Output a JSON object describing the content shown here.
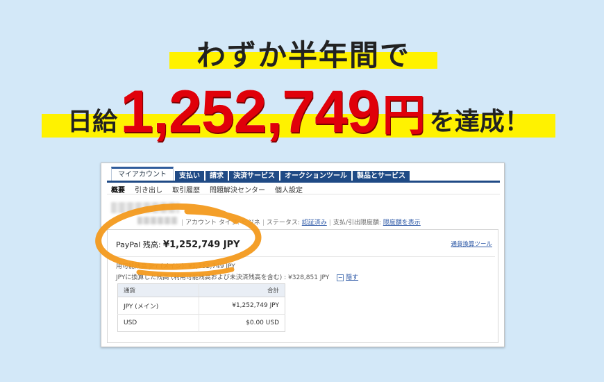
{
  "headline": {
    "line1": "わずか半年間で",
    "prefix": "日給",
    "amount": "1,252,749",
    "unit": "円",
    "suffix": "を達成！"
  },
  "nav": {
    "tabs": [
      "マイアカウント",
      "支払い",
      "請求",
      "決済サービス",
      "オークションツール",
      "製品とサービス"
    ],
    "subnav": [
      "概要",
      "引き出し",
      "取引履歴",
      "問題解決センター",
      "個人設定"
    ]
  },
  "account": {
    "type_label": "アカウント タイプ: ビジネ",
    "status_label": "ステータス:",
    "status_value": "認証済み",
    "limit_label": "支払/引出限度額:",
    "limit_link": "限度額を表示"
  },
  "balance": {
    "label": "PayPal 残高:",
    "value": "¥1,252,749 JPY",
    "converter_link": "通貨換算ツール",
    "line1": "用可能残高 JPY (メイン): ¥1,252,749 JPY",
    "line2": "JPYに換算した残高 (利用可能残高および未決済残高を含む) : ¥328,851 JPY",
    "hide_label": "隠す"
  },
  "table": {
    "headers": [
      "通貨",
      "合計"
    ],
    "rows": [
      {
        "currency": "JPY (メイン)",
        "total": "¥1,252,749 JPY"
      },
      {
        "currency": "USD",
        "total": "$0.00 USD"
      }
    ]
  },
  "colors": {
    "background": "#d3e8f8",
    "highlight": "#fff200",
    "amount_red": "#e0000a",
    "tab_blue": "#1f4a85",
    "marker_orange": "#f39a1e"
  }
}
